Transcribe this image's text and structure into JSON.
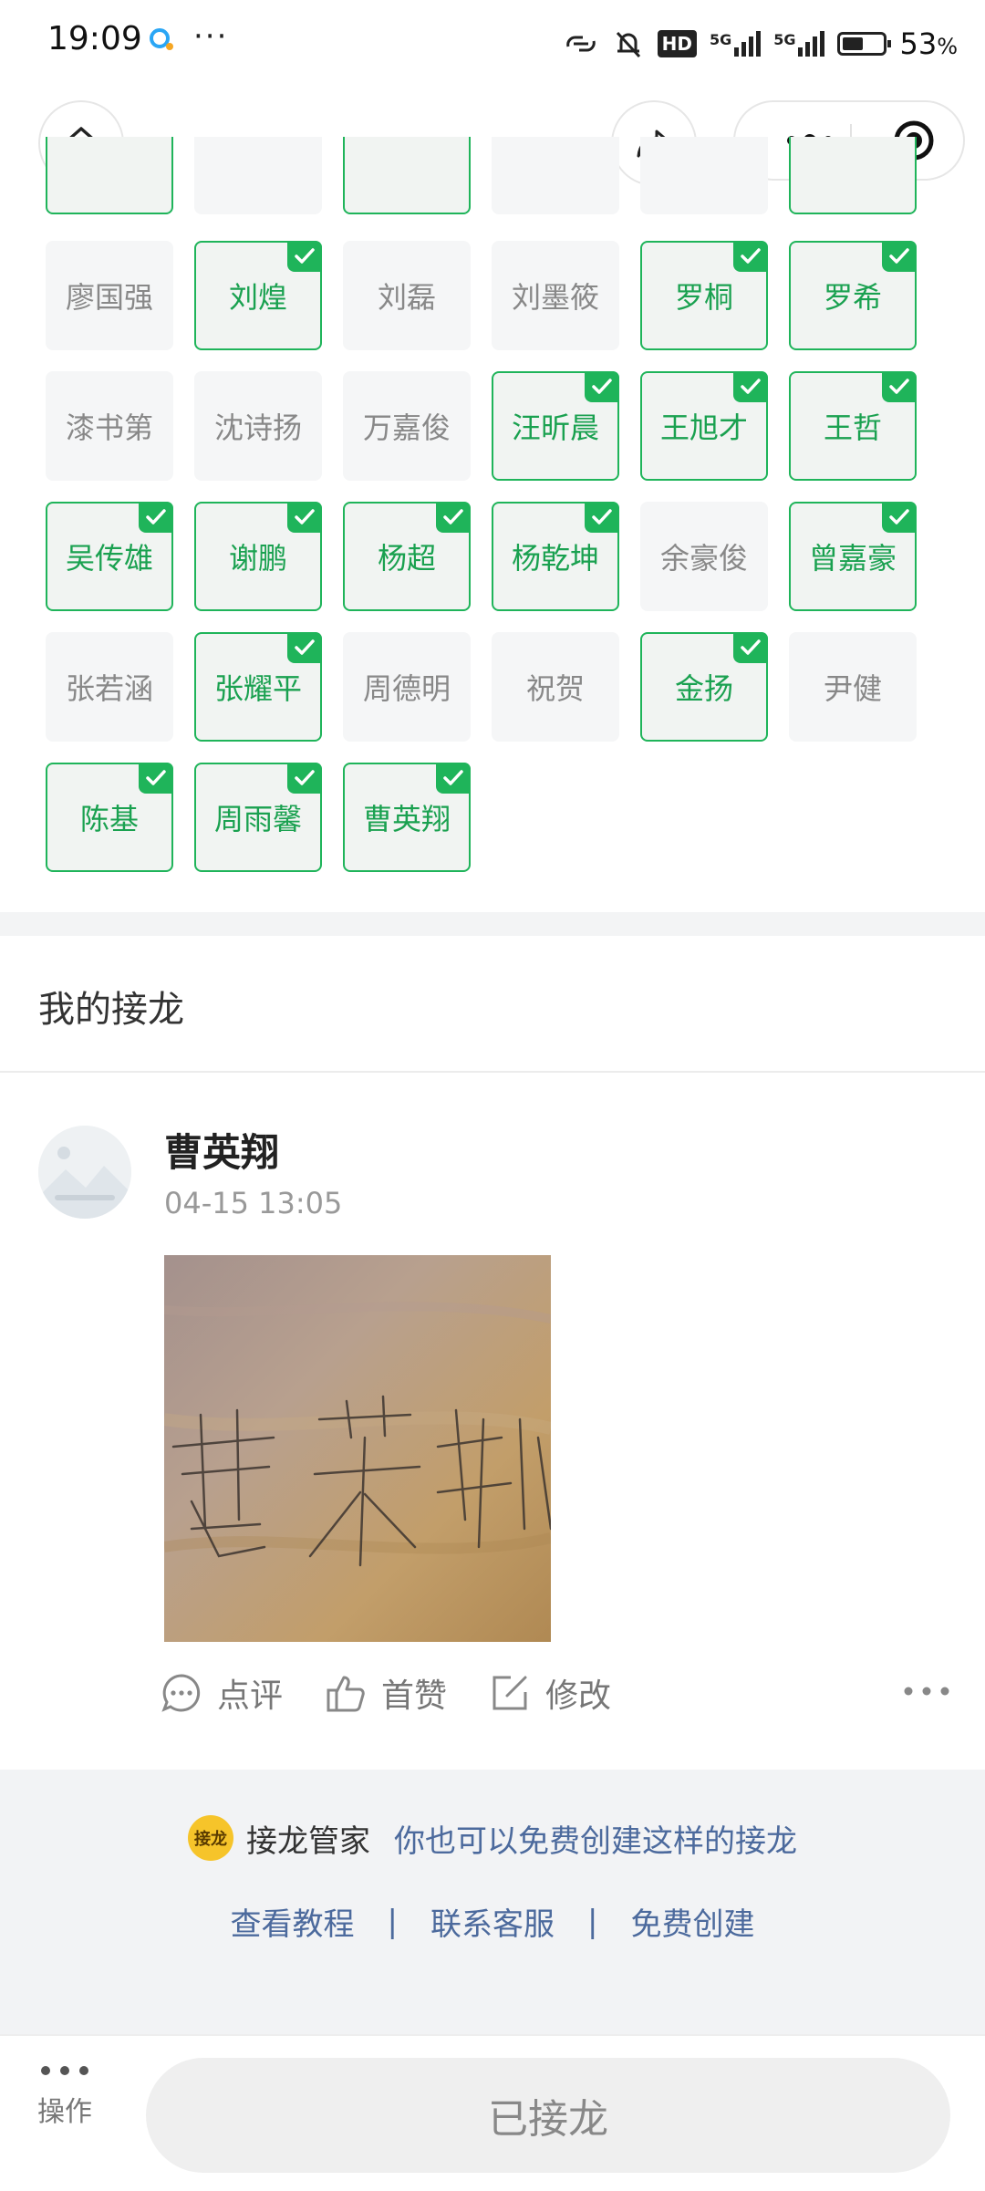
{
  "status_bar": {
    "time": "19:09",
    "battery_percent": "53",
    "percent_sign": "%",
    "hd_label": "HD",
    "signal_label": "5G"
  },
  "nav": {
    "home_icon": "home-icon",
    "share_icon": "share-icon"
  },
  "names": [
    {
      "name": "",
      "selected": true
    },
    {
      "name": "",
      "selected": false
    },
    {
      "name": "",
      "selected": true
    },
    {
      "name": "",
      "selected": false
    },
    {
      "name": "",
      "selected": false
    },
    {
      "name": "",
      "selected": true
    },
    {
      "name": "廖国强",
      "selected": false
    },
    {
      "name": "刘煌",
      "selected": true
    },
    {
      "name": "刘磊",
      "selected": false
    },
    {
      "name": "刘墨筱",
      "selected": false
    },
    {
      "name": "罗桐",
      "selected": true
    },
    {
      "name": "罗希",
      "selected": true
    },
    {
      "name": "漆书第",
      "selected": false
    },
    {
      "name": "沈诗扬",
      "selected": false
    },
    {
      "name": "万嘉俊",
      "selected": false
    },
    {
      "name": "汪昕晨",
      "selected": true
    },
    {
      "name": "王旭才",
      "selected": true
    },
    {
      "name": "王哲",
      "selected": true
    },
    {
      "name": "吴传雄",
      "selected": true
    },
    {
      "name": "谢鹏",
      "selected": true
    },
    {
      "name": "杨超",
      "selected": true
    },
    {
      "name": "杨乾坤",
      "selected": true
    },
    {
      "name": "余豪俊",
      "selected": false
    },
    {
      "name": "曾嘉豪",
      "selected": true
    },
    {
      "name": "张若涵",
      "selected": false
    },
    {
      "name": "张耀平",
      "selected": true
    },
    {
      "name": "周德明",
      "selected": false
    },
    {
      "name": "祝贺",
      "selected": false
    },
    {
      "name": "金扬",
      "selected": true
    },
    {
      "name": "尹健",
      "selected": false
    },
    {
      "name": "陈基",
      "selected": true
    },
    {
      "name": "周雨馨",
      "selected": true
    },
    {
      "name": "曹英翔",
      "selected": true
    }
  ],
  "my_section": {
    "title": "我的接龙"
  },
  "post": {
    "name": "曹英翔",
    "time": "04-15 13:05",
    "actions": {
      "comment": "点评",
      "like": "首赞",
      "edit": "修改"
    }
  },
  "footer": {
    "badge": "接龙",
    "brand": "接龙管家",
    "promo": "你也可以免费创建这样的接龙",
    "links": [
      "查看教程",
      "联系客服",
      "免费创建"
    ],
    "separator": "|"
  },
  "bottom_bar": {
    "operate_label": "操作",
    "joined_label": "已接龙"
  },
  "colors": {
    "accent_green": "#1fb45a",
    "link_blue": "#4c6a9d"
  }
}
